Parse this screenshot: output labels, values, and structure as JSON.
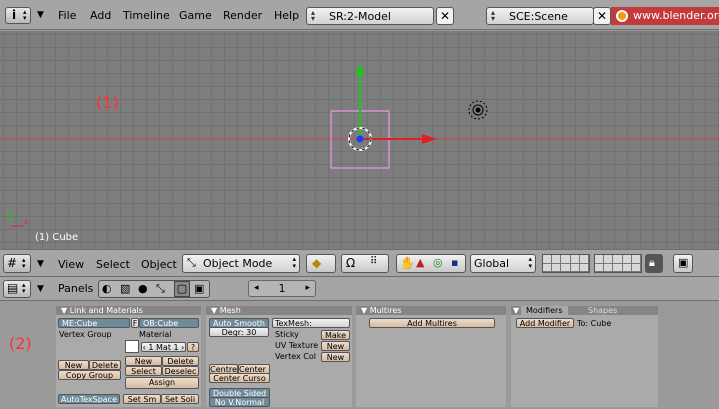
{
  "topbar": {
    "menus": [
      "File",
      "Add",
      "Timeline",
      "Game",
      "Render",
      "Help"
    ],
    "screen": "SR:2-Model",
    "scene": "SCE:Scene",
    "url": "www.blender.org"
  },
  "viewport": {
    "label": "(1)",
    "object_label": "(1) Cube"
  },
  "view_header": {
    "menus": [
      "View",
      "Select",
      "Object"
    ],
    "mode": "Object Mode",
    "orientation": "Global"
  },
  "buttons_header": {
    "panels_label": "Panels",
    "page": "1"
  },
  "buttons_window": {
    "label": "(2)",
    "link_materials": {
      "title": "Link and Materials",
      "mesh_name": "ME:Cube",
      "f_label": "F",
      "ob_name": "OB:Cube",
      "vertex_group": "Vertex Group",
      "material": "Material",
      "mat_slot": "1 Mat 1",
      "question": "?",
      "new": "New",
      "delete": "Delete",
      "copy_group": "Copy Group",
      "select": "Select",
      "deselect": "Deselec",
      "assign": "Assign",
      "autotexspace": "AutoTexSpace",
      "set_smooth": "Set Sm",
      "set_solid": "Set Soli"
    },
    "mesh": {
      "title": "Mesh",
      "auto_smooth": "Auto Smooth",
      "degr": "Degr: 30",
      "texmesh": "TexMesh:",
      "sticky": "Sticky",
      "make": "Make",
      "uv_texture": "UV Texture",
      "uv_new": "New",
      "vertex_col": "Vertex Col",
      "vc_new": "New",
      "centre": "Centre",
      "center_new": "Center New",
      "center_cursor": "Center Curso",
      "double_sided": "Double Sided",
      "no_vnormal": "No V.Normal"
    },
    "multires": {
      "title": "Multires",
      "add": "Add Multires"
    },
    "modifiers": {
      "tab_modifiers": "Modifiers",
      "tab_shapes": "Shapes",
      "add": "Add Modifier",
      "to": "To: Cube"
    }
  }
}
